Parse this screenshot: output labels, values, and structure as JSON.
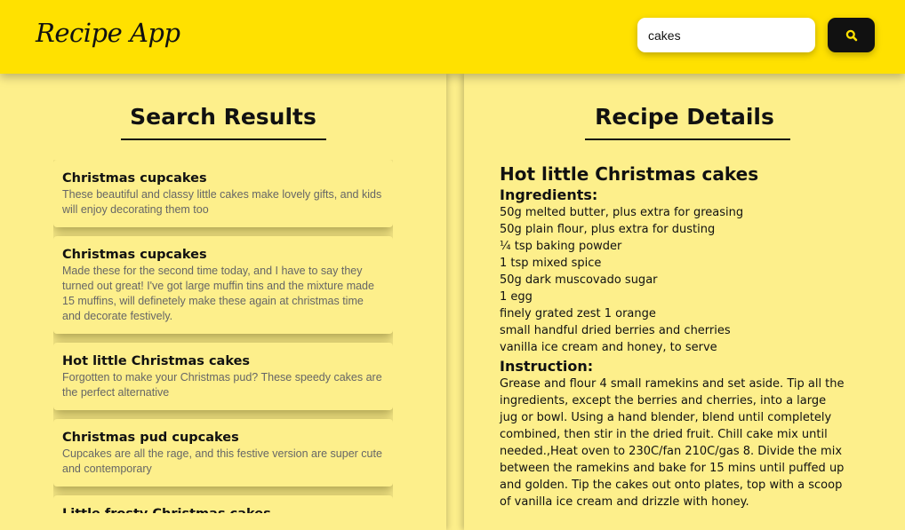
{
  "app": {
    "title": "Recipe App"
  },
  "search": {
    "value": "cakes",
    "button_icon": "search-icon"
  },
  "results": {
    "heading": "Search Results",
    "items": [
      {
        "title": "Christmas cupcakes",
        "description": "These beautiful and classy little cakes make lovely gifts, and kids will enjoy decorating them too"
      },
      {
        "title": "Christmas cupcakes",
        "description": "Made these for the second time today, and I have to say they turned out great! I've got large muffin tins and the mixture made 15 muffins, will definetely make these again at christmas time and decorate festively."
      },
      {
        "title": "Hot little Christmas cakes",
        "description": "Forgotten to make your Christmas pud? These speedy cakes are the perfect alternative"
      },
      {
        "title": "Christmas pud cupcakes",
        "description": "Cupcakes are all the rage, and this festive version are super cute and contemporary"
      },
      {
        "title": "Little frosty Christmas cakes",
        "description": ""
      }
    ]
  },
  "details": {
    "heading": "Recipe Details",
    "recipe_name": "Hot little Christmas cakes",
    "ingredients_heading": "Ingredients:",
    "ingredients": [
      "50g melted butter, plus extra for greasing",
      "50g plain flour, plus extra for dusting",
      "¼ tsp baking powder",
      "1 tsp mixed spice",
      "50g dark muscovado sugar",
      "1 egg",
      "finely grated zest 1 orange",
      "small handful dried berries and cherries",
      "vanilla ice cream and honey, to serve"
    ],
    "instruction_heading": "Instruction:",
    "instruction": "Grease and flour 4 small ramekins and set aside. Tip all the ingredients, except the berries and cherries, into a large jug or bowl. Using a hand blender, blend until completely combined, then stir in the dried fruit. Chill cake mix until needed.,Heat oven to 230C/fan 210C/gas 8. Divide the mix between the ramekins and bake for 15 mins until puffed up and golden. Tip the cakes out onto plates, top with a scoop of vanilla ice cream and drizzle with honey."
  },
  "colors": {
    "header": "#ffe100",
    "panel": "#fdef8b",
    "button": "#111111",
    "icon": "#ffe100"
  }
}
